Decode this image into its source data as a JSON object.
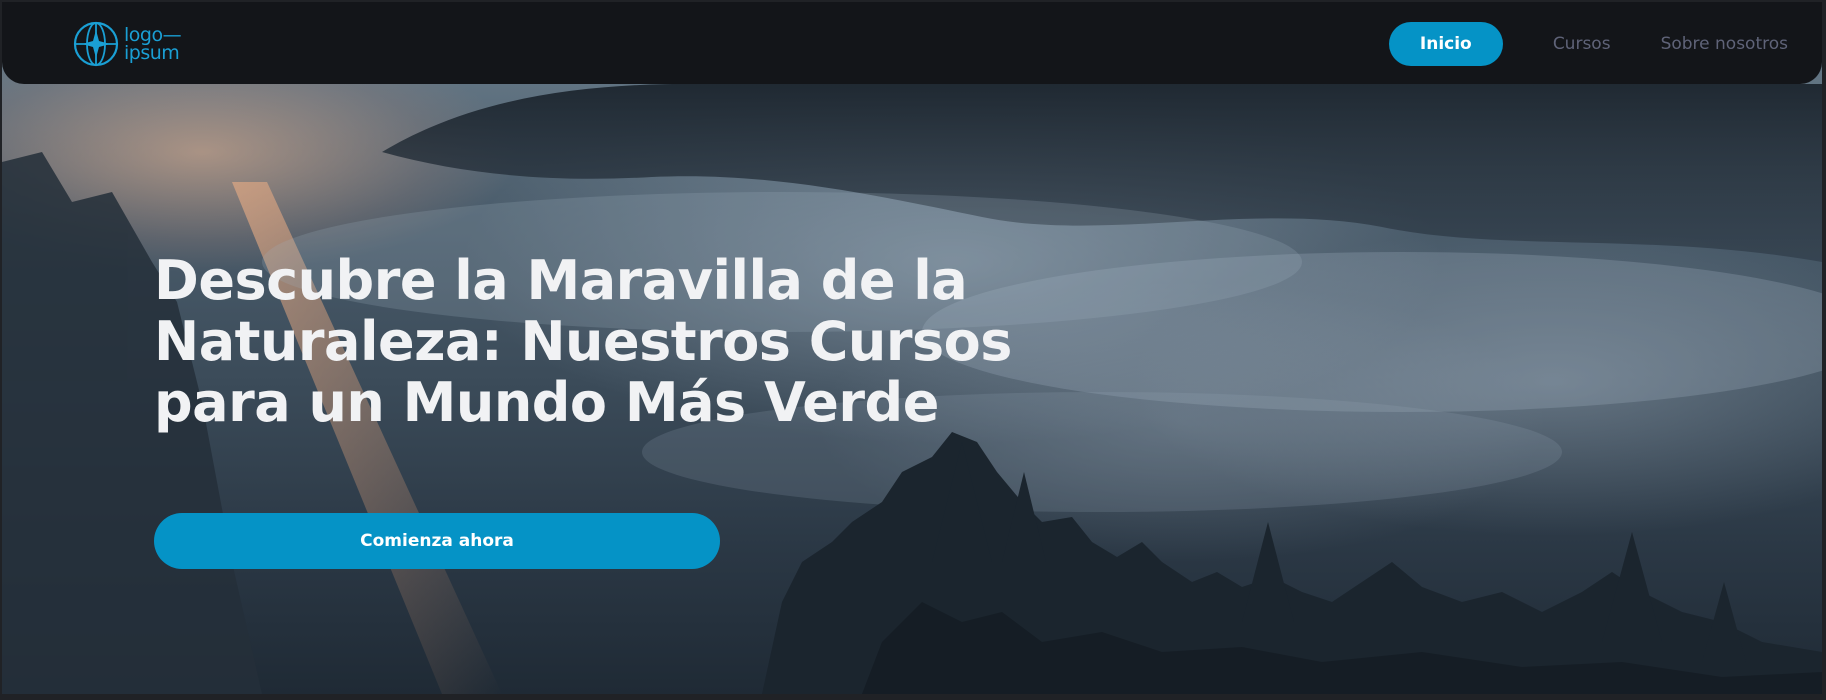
{
  "brand": {
    "logo_line1": "logo—",
    "logo_line2": "ipsum",
    "accent_color": "#0593c6",
    "navbar_color": "#131519"
  },
  "nav": {
    "items": [
      {
        "label": "Inicio",
        "active": true
      },
      {
        "label": "Cursos",
        "active": false
      },
      {
        "label": "Sobre nosotros",
        "active": false
      }
    ]
  },
  "hero": {
    "headline": "Descubre la Maravilla de la Naturaleza: Nuestros Cursos para un Mundo Más Verde",
    "cta_label": "Comienza ahora",
    "background_image": "misty-forest-icon"
  }
}
